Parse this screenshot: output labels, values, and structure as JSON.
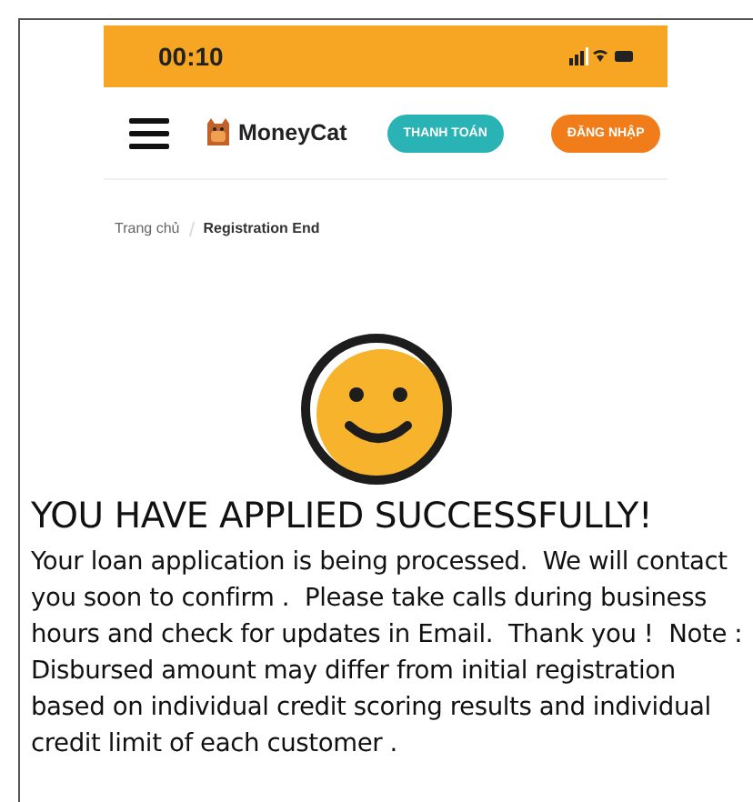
{
  "status_bar": {
    "time": "00:10"
  },
  "nav": {
    "brand": "MoneyCat",
    "buttons": [
      {
        "label": "THANH TOÁN",
        "kind": "pay"
      },
      {
        "label": "ĐĂNG NHẬP",
        "kind": "login"
      }
    ]
  },
  "breadcrumb": [
    {
      "label": "Trang chủ",
      "selected": false
    },
    {
      "label": "Registration End",
      "selected": true
    }
  ],
  "heading": "YOU HAVE APPLIED SUCCESSFULLY!",
  "message": "Your loan application is being processed.  We will contact you soon to confirm .  Please take calls during business hours and check for updates in Email.  Thank you !  Note : Disbursed amount may differ from initial registration based on individual credit scoring results and individual credit limit of each customer ."
}
